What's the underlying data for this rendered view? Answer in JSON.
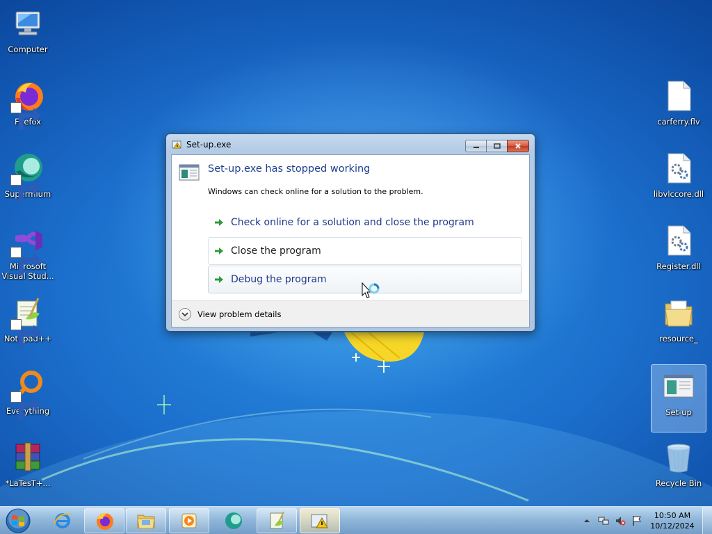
{
  "desktop": {
    "left_icons": [
      {
        "label": "Computer",
        "icon": "computer-icon",
        "shortcut": false
      },
      {
        "label": "Firefox",
        "icon": "firefox-icon",
        "shortcut": true
      },
      {
        "label": "Supermium",
        "icon": "supermium-icon",
        "shortcut": true
      },
      {
        "label": "Microsoft Visual Stud...",
        "icon": "visual-studio-icon",
        "shortcut": true
      },
      {
        "label": "Notepad++",
        "icon": "notepad-plus-plus-icon",
        "shortcut": true
      },
      {
        "label": "Everything",
        "icon": "everything-search-icon",
        "shortcut": true
      },
      {
        "label": "*LaTesT+...",
        "icon": "winrar-icon",
        "shortcut": false
      }
    ],
    "right_icons": [
      {
        "label": "carferry.flv",
        "icon": "file-icon"
      },
      {
        "label": "libvlccore.dll",
        "icon": "dll-file-icon"
      },
      {
        "label": "Register.dll",
        "icon": "dll-file-icon"
      },
      {
        "label": "resource_",
        "icon": "folder-icon"
      },
      {
        "label": "Set-up",
        "icon": "setup-exe-icon",
        "selected": true
      },
      {
        "label": "Recycle Bin",
        "icon": "recycle-bin-icon"
      }
    ]
  },
  "dialog": {
    "title": "Set-up.exe",
    "heading": "Set-up.exe has stopped working",
    "description": "Windows can check online for a solution to the problem.",
    "options": [
      {
        "label": "Check online for a solution and close the program"
      },
      {
        "label": "Close the program"
      },
      {
        "label": "Debug the program"
      }
    ],
    "details_label": "View problem details",
    "window_buttons": {
      "minimize": "minimize",
      "maximize": "maximize",
      "close": "close"
    }
  },
  "taskbar": {
    "apps": [
      {
        "name": "internet-explorer",
        "state": "pinned"
      },
      {
        "name": "firefox",
        "state": "open"
      },
      {
        "name": "file-explorer",
        "state": "open"
      },
      {
        "name": "media-player",
        "state": "open"
      },
      {
        "name": "supermium",
        "state": "pinned"
      },
      {
        "name": "notepad-plus-plus",
        "state": "open"
      },
      {
        "name": "setup-error",
        "state": "active"
      }
    ],
    "clock": {
      "time": "10:50 AM",
      "date": "10/12/2024"
    }
  },
  "colors": {
    "dialog_heading": "#1d3f8f",
    "command_link": "#1f3a8a",
    "arrow_green": "#2e9a3a",
    "wallpaper": "#1c6fcd"
  }
}
